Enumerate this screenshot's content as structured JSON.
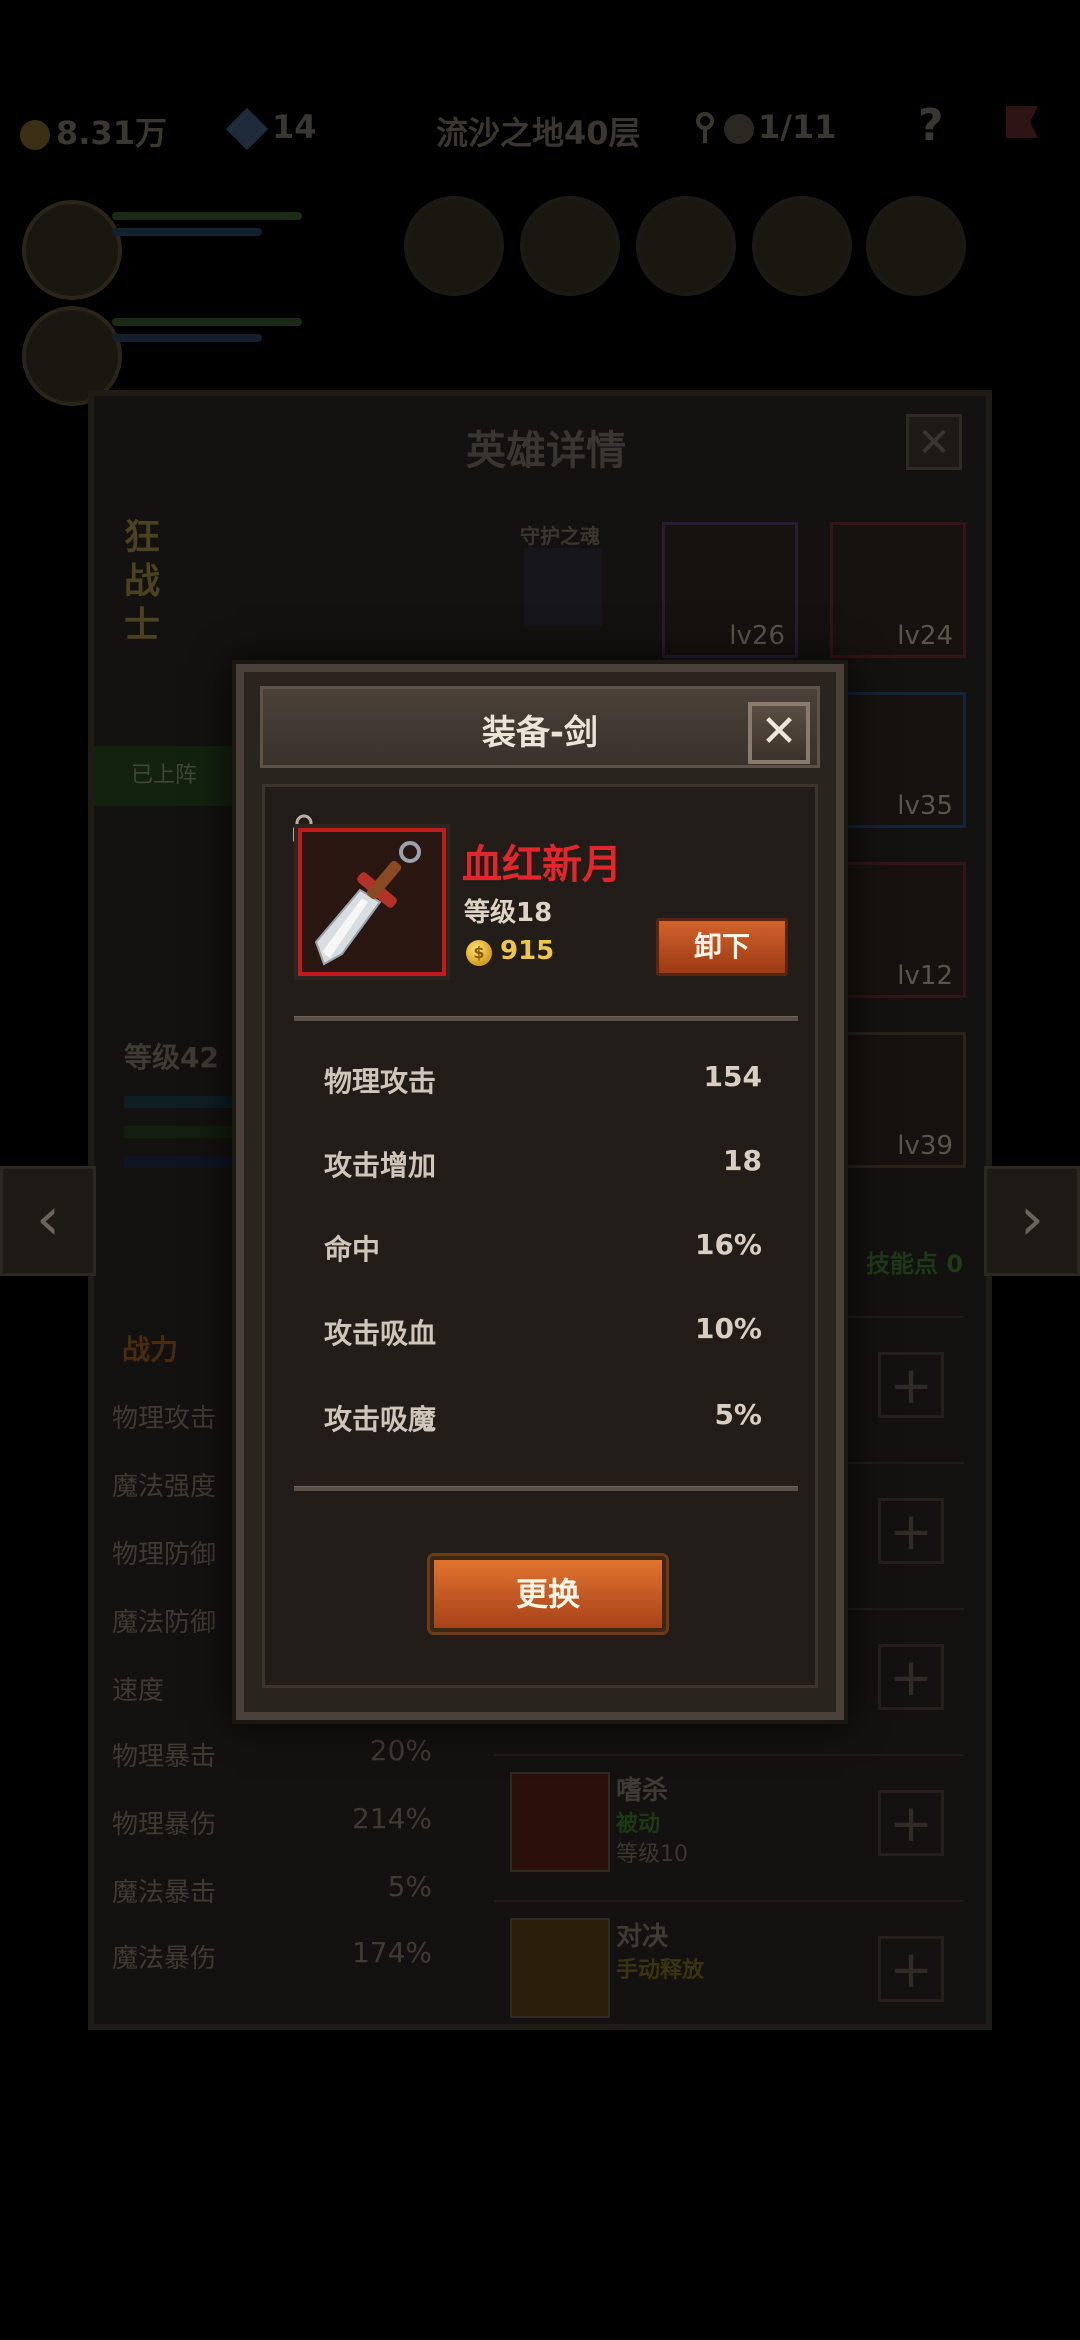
{
  "topbar": {
    "gold": "8.31万",
    "gems": "14",
    "stage": "流沙之地40层",
    "keys": "1/11",
    "help": "?"
  },
  "hero_panel": {
    "title": "英雄详情",
    "close": "✕",
    "hero_class": "狂战士",
    "guardian_label": "守护之魂",
    "deployed_label": "已上阵",
    "level": "等级42",
    "skill_points": "技能点 0",
    "equipment": [
      {
        "level": "lv26",
        "border": "#7a3fa8"
      },
      {
        "level": "lv24",
        "border": "#a8222a"
      },
      {
        "level": "lv35",
        "border": "#2f6fb8"
      },
      {
        "level": "lv12",
        "border": "#a8222a"
      },
      {
        "level": "lv39",
        "border": "#3a3228"
      }
    ],
    "stats_tab": "战力",
    "stats": [
      {
        "label": "物理攻击",
        "value": ""
      },
      {
        "label": "魔法强度",
        "value": ""
      },
      {
        "label": "物理防御",
        "value": ""
      },
      {
        "label": "魔法防御",
        "value": ""
      },
      {
        "label": "速度",
        "value": ""
      },
      {
        "label": "物理暴击",
        "value": "20%"
      },
      {
        "label": "物理暴伤",
        "value": "214%"
      },
      {
        "label": "魔法暴击",
        "value": "5%"
      },
      {
        "label": "魔法暴伤",
        "value": "174%"
      }
    ],
    "skills": [
      {
        "name": "嗜杀",
        "type": "被动",
        "level": "等级10"
      },
      {
        "name": "对决",
        "type": "手动释放",
        "level": ""
      }
    ]
  },
  "modal": {
    "title": "装备-剑",
    "close": "✕",
    "item": {
      "name": "血红新月",
      "level": "等级18",
      "price": "915",
      "rarity_color": "#c01c1c"
    },
    "unequip_label": "卸下",
    "attributes": [
      {
        "label": "物理攻击",
        "value": "154"
      },
      {
        "label": "攻击增加",
        "value": "18"
      },
      {
        "label": "命中",
        "value": "16%"
      },
      {
        "label": "攻击吸血",
        "value": "10%"
      },
      {
        "label": "攻击吸魔",
        "value": "5%"
      }
    ],
    "replace_label": "更换"
  }
}
